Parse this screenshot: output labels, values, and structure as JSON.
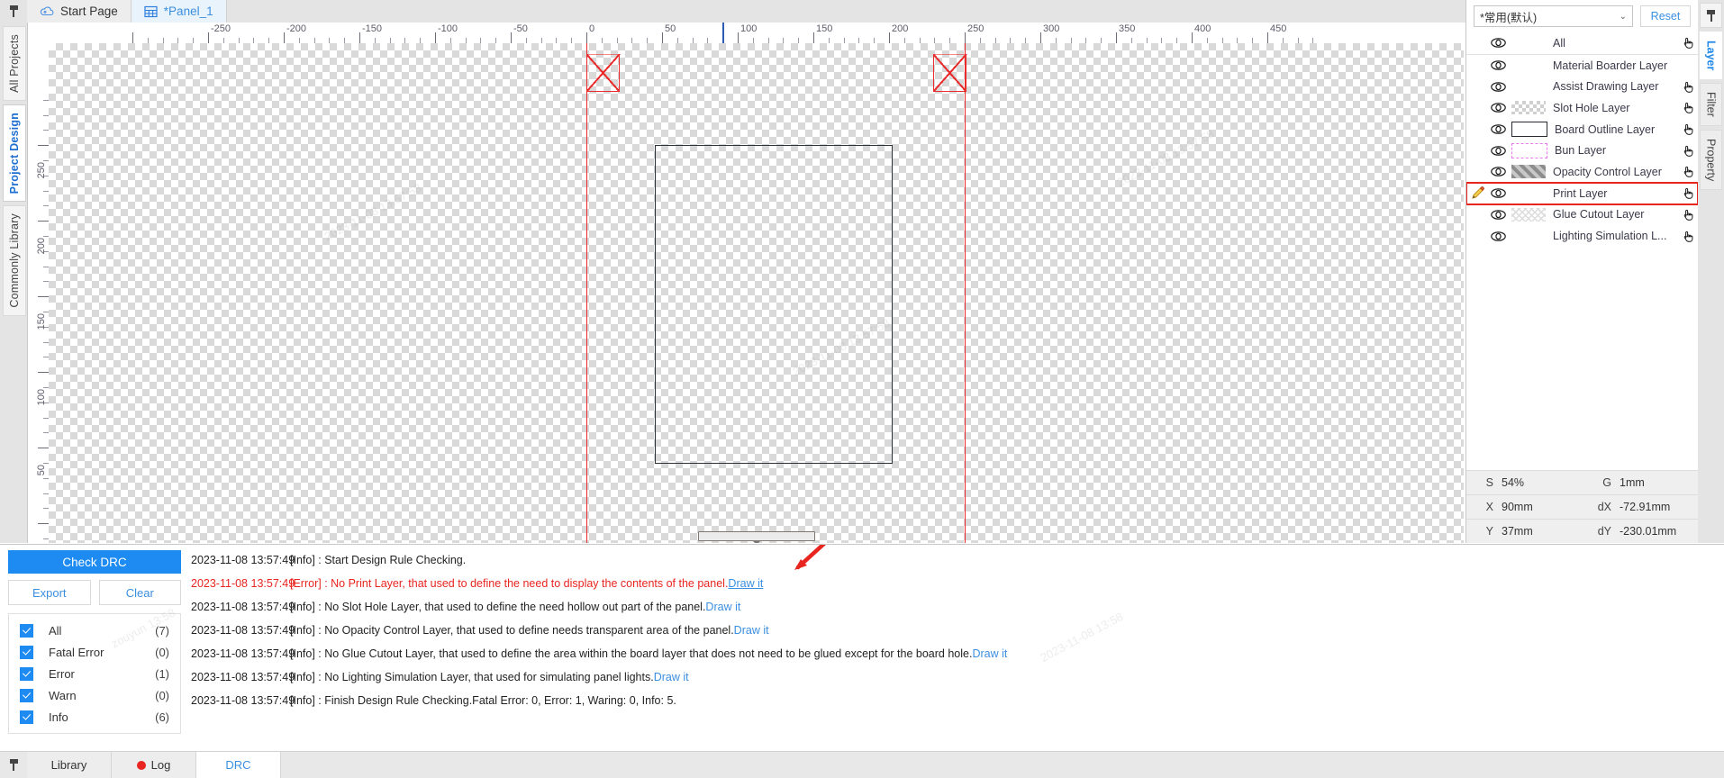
{
  "window": {
    "doc_tabs": [
      {
        "label": "Start Page",
        "icon": "cloud-icon",
        "selected": false
      },
      {
        "label": "*Panel_1",
        "icon": "panel-grid-icon",
        "selected": true
      }
    ],
    "pin_icon": "pin-icon"
  },
  "left_dock": {
    "tabs": [
      {
        "label": "All Projects",
        "selected": false
      },
      {
        "label": "Project Design",
        "selected": true
      },
      {
        "label": "Commonly Library",
        "selected": false
      }
    ]
  },
  "canvas": {
    "h_ruler_labels": [
      "-250",
      "-200",
      "-150",
      "-100",
      "-50",
      "0",
      "50",
      "100",
      "150",
      "200",
      "250",
      "300",
      "350",
      "400",
      "450"
    ],
    "v_ruler_labels": [
      "250",
      "200",
      "150",
      "100",
      "50"
    ],
    "cursor_x_label": "90",
    "splitter_icon": "splitter-handle"
  },
  "layer_panel": {
    "preset_value": "*常用(默认)",
    "preset_caret": "⌄",
    "reset_label": "Reset",
    "eye_icon": "eye-icon",
    "hand_icon": "hand-pointer-icon",
    "pencil_icon": "pencil-icon",
    "rows": [
      {
        "name": "All",
        "swatch": "none",
        "hand": true,
        "pencil": false,
        "active": false
      },
      {
        "name": "Material Boarder Layer",
        "swatch": "none",
        "hand": false,
        "pencil": false,
        "active": false
      },
      {
        "name": "Assist Drawing Layer",
        "swatch": "none",
        "hand": true,
        "pencil": false,
        "active": false
      },
      {
        "name": "Slot Hole Layer",
        "swatch": "checker",
        "hand": true,
        "pencil": false,
        "active": false
      },
      {
        "name": "Board Outline Layer",
        "swatch": "outline",
        "hand": true,
        "pencil": false,
        "active": false
      },
      {
        "name": "Bun Layer",
        "swatch": "bun",
        "hand": true,
        "pencil": false,
        "active": false
      },
      {
        "name": "Opacity Control Layer",
        "swatch": "opacity",
        "hand": true,
        "pencil": false,
        "active": false
      },
      {
        "name": "Print Layer",
        "swatch": "none",
        "hand": true,
        "pencil": true,
        "active": true
      },
      {
        "name": "Glue Cutout Layer",
        "swatch": "glue",
        "hand": true,
        "pencil": false,
        "active": false
      },
      {
        "name": "Lighting Simulation L...",
        "swatch": "none",
        "hand": true,
        "pencil": false,
        "active": false
      }
    ]
  },
  "status": {
    "scale_key": "S",
    "scale_value": "54%",
    "grid_key": "G",
    "grid_value": "1mm",
    "x_key": "X",
    "x_value": "90mm",
    "dx_key": "dX",
    "dx_value": "-72.91mm",
    "y_key": "Y",
    "y_value": "37mm",
    "dy_key": "dY",
    "dy_value": "-230.01mm"
  },
  "right_dock": {
    "pin_icon": "pin-icon",
    "tabs": [
      {
        "label": "Layer",
        "selected": true
      },
      {
        "label": "Filter",
        "selected": false
      },
      {
        "label": "Property",
        "selected": false
      }
    ]
  },
  "drc": {
    "check_label": "Check DRC",
    "export_label": "Export",
    "clear_label": "Clear",
    "filters": [
      {
        "label": "All",
        "count": "(7)",
        "checked": true
      },
      {
        "label": "Fatal Error",
        "count": "(0)",
        "checked": true
      },
      {
        "label": "Error",
        "count": "(1)",
        "checked": true
      },
      {
        "label": "Warn",
        "count": "(0)",
        "checked": true
      },
      {
        "label": "Info",
        "count": "(6)",
        "checked": true
      }
    ],
    "log": [
      {
        "ts": "2023-11-08 13:57:49",
        "text": "[Info] : Start Design Rule Checking.",
        "link": "",
        "level": "info",
        "link_underline": false
      },
      {
        "ts": "2023-11-08 13:57:49",
        "text": "[Error] : No Print Layer, that used to define the need to display the contents of the panel.",
        "link": "Draw it",
        "level": "error",
        "link_underline": true
      },
      {
        "ts": "2023-11-08 13:57:49",
        "text": "[Info] : No Slot Hole Layer, that used to define the need hollow out part of the panel.",
        "link": "Draw it",
        "level": "info",
        "link_underline": false
      },
      {
        "ts": "2023-11-08 13:57:49",
        "text": "[Info] : No Opacity Control Layer, that used to define needs transparent area of the panel.",
        "link": "Draw it",
        "level": "info",
        "link_underline": false
      },
      {
        "ts": "2023-11-08 13:57:49",
        "text": "[Info] : No Glue Cutout Layer, that used to define the area within the board layer that does not need to be glued except for the board hole.",
        "link": "Draw it",
        "level": "info",
        "link_underline": false
      },
      {
        "ts": "2023-11-08 13:57:49",
        "text": "[Info] : No Lighting Simulation Layer, that used for simulating panel lights.",
        "link": "Draw it",
        "level": "info",
        "link_underline": false
      },
      {
        "ts": "2023-11-08 13:57:49",
        "text": "[Info] : Finish Design Rule Checking.Fatal Error: 0, Error: 1, Waring: 0, Info: 5.",
        "link": "",
        "level": "info",
        "link_underline": false
      }
    ]
  },
  "bottom_tabs": {
    "pin_icon": "pin-icon",
    "tabs": [
      {
        "label": "Library",
        "icon": "none",
        "selected": false
      },
      {
        "label": "Log",
        "icon": "red-dot-icon",
        "selected": false
      },
      {
        "label": "DRC",
        "icon": "none",
        "selected": true
      }
    ]
  },
  "colors": {
    "accent": "#1d8bf1",
    "link": "#3b8fe0",
    "error": "#e8251f",
    "guide": "#ea2b2b"
  }
}
